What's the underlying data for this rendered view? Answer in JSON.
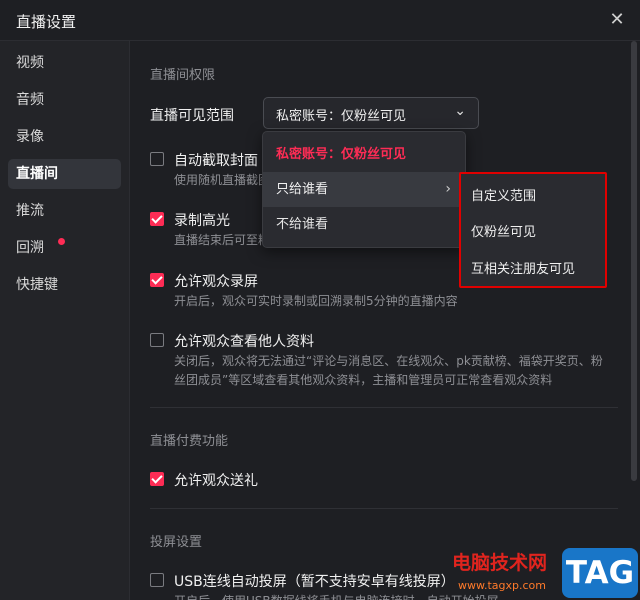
{
  "window": {
    "title": "直播设置"
  },
  "sidebar": {
    "items": [
      {
        "label": "视频"
      },
      {
        "label": "音频"
      },
      {
        "label": "录像"
      },
      {
        "label": "直播间"
      },
      {
        "label": "推流"
      },
      {
        "label": "回溯"
      },
      {
        "label": "快捷键"
      }
    ],
    "active_index": 3,
    "badge_item_index": 5
  },
  "main": {
    "section_permissions": "直播间权限",
    "visibility": {
      "label": "直播可见范围",
      "value": "私密账号：仅粉丝可见"
    },
    "options": [
      {
        "label": "自动截取封面",
        "desc": [
          "使用随机直播截图作为封面"
        ],
        "checked": false
      },
      {
        "label": "录制高光",
        "desc": [
          "直播结束后可至精彩回放查看"
        ],
        "checked": true
      },
      {
        "label": "允许观众录屏",
        "desc": [
          "开启后，观众可实时录制或回溯录制5分钟的直播内容"
        ],
        "checked": true
      },
      {
        "label": "允许观众查看他人资料",
        "desc": [
          "关闭后，观众将无法通过“评论与消息区、在线观众、pk贡献榜、福袋开奖页、粉",
          "丝团成员”等区域查看其他观众资料，主播和管理员可正常查看观众资料"
        ],
        "checked": false
      }
    ],
    "section_paid": "直播付费功能",
    "paid_option": {
      "label": "允许观众送礼",
      "checked": true
    },
    "section_cast": "投屏设置",
    "cast_option": {
      "label": "USB连线自动投屏（暂不支持安卓有线投屏）",
      "desc": [
        "开启后，使用USB数据线将手机与电脑连接时，自动开始投屏"
      ],
      "checked": false
    }
  },
  "dropdown": {
    "items": [
      {
        "label": "私密账号：仅粉丝可见",
        "selected": true
      },
      {
        "label": "只给谁看",
        "has_submenu": true
      },
      {
        "label": "不给谁看"
      }
    ]
  },
  "submenu": {
    "items": [
      {
        "label": "自定义范围"
      },
      {
        "label": "仅粉丝可见"
      },
      {
        "label": "互相关注朋友可见"
      }
    ]
  },
  "watermark": {
    "site_name": "电脑技术网",
    "url": "www.tagxp.com",
    "tag": "TAG"
  },
  "colors": {
    "accent": "#fe2c55",
    "highlight_box": "#e00000",
    "background": "#1e1f23"
  }
}
